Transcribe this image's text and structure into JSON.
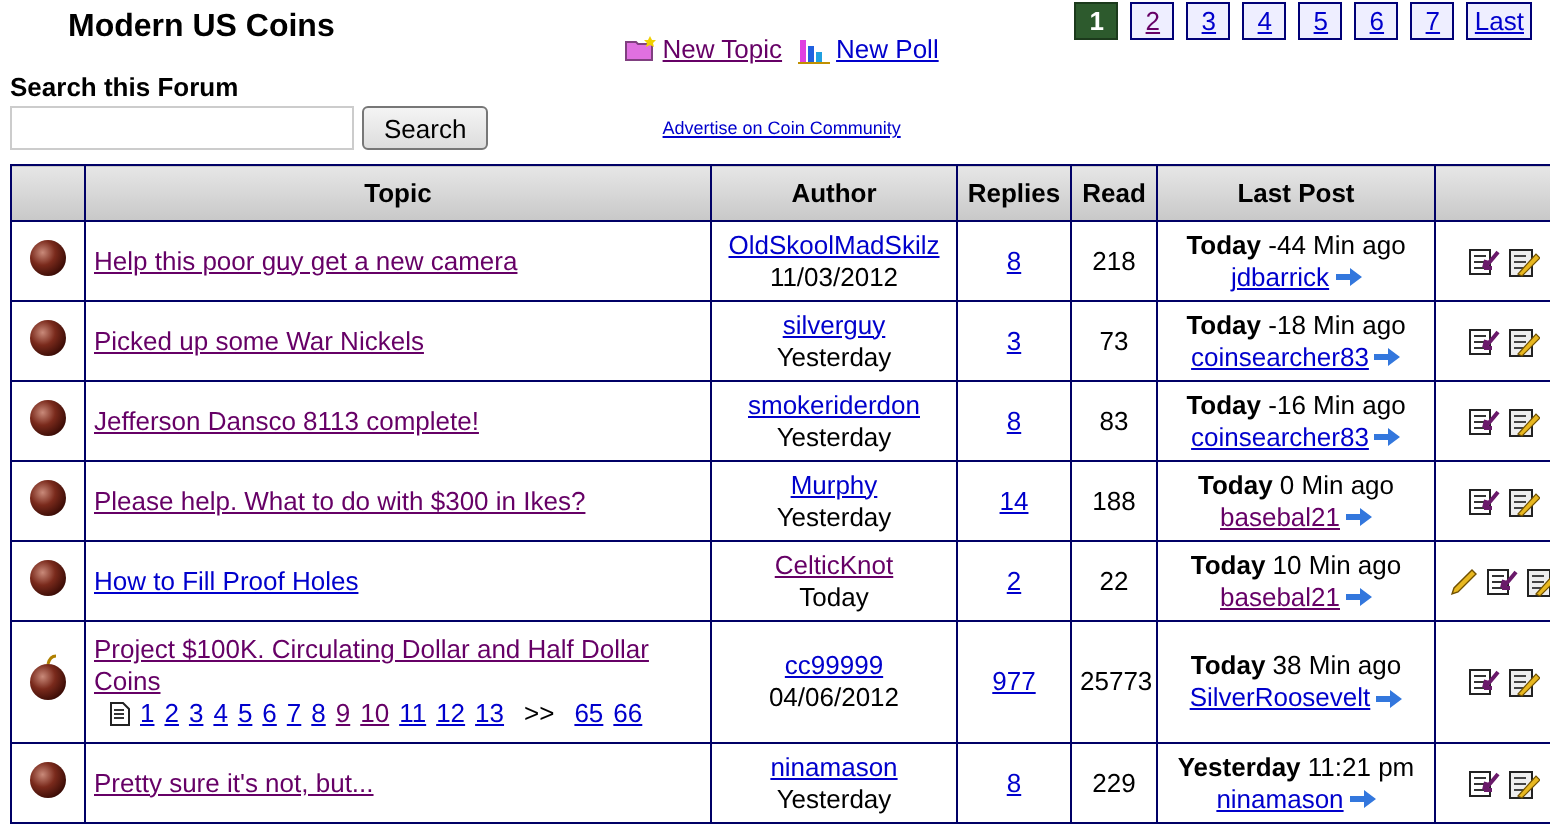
{
  "forum_title": "Modern US Coins",
  "actions": [
    {
      "kind": "topic",
      "label": "New Topic",
      "visited": true
    },
    {
      "kind": "poll",
      "label": "New Poll",
      "visited": false
    }
  ],
  "pagination": [
    {
      "label": "1",
      "selected": true,
      "visited": false
    },
    {
      "label": "2",
      "selected": false,
      "visited": true
    },
    {
      "label": "3",
      "selected": false,
      "visited": false
    },
    {
      "label": "4",
      "selected": false,
      "visited": false
    },
    {
      "label": "5",
      "selected": false,
      "visited": false
    },
    {
      "label": "6",
      "selected": false,
      "visited": false
    },
    {
      "label": "7",
      "selected": false,
      "visited": false
    },
    {
      "label": "Last",
      "selected": false,
      "visited": false
    }
  ],
  "search": {
    "label": "Search this Forum",
    "button": "Search"
  },
  "advertise_link": "Advertise on Coin Community",
  "table": {
    "columns": [
      "Topic",
      "Author",
      "Replies",
      "Read",
      "Last Post"
    ],
    "rows": [
      {
        "kind": "normal",
        "topic": "Help this poor guy get a new camera",
        "topic_visited": true,
        "author": "OldSkoolMadSkilz",
        "author_visited": false,
        "date": "11/03/2012",
        "replies": "8",
        "read": "218",
        "last_day": "Today",
        "last_time": "-44 Min ago",
        "last_user": "jdbarrick",
        "last_user_visited": false,
        "editable": false
      },
      {
        "kind": "normal",
        "topic": "Picked up some War Nickels",
        "topic_visited": true,
        "author": "silverguy",
        "author_visited": false,
        "date": "Yesterday",
        "replies": "3",
        "read": "73",
        "last_day": "Today",
        "last_time": "-18 Min ago",
        "last_user": "coinsearcher83",
        "last_user_visited": false,
        "editable": false
      },
      {
        "kind": "normal",
        "topic": "Jefferson Dansco 8113 complete!",
        "topic_visited": true,
        "author": "smokeriderdon",
        "author_visited": false,
        "date": "Yesterday",
        "replies": "8",
        "read": "83",
        "last_day": "Today",
        "last_time": "-16 Min ago",
        "last_user": "coinsearcher83",
        "last_user_visited": false,
        "editable": false
      },
      {
        "kind": "normal",
        "topic": "Please help. What to do with $300 in Ikes?",
        "topic_visited": true,
        "author": "Murphy",
        "author_visited": false,
        "date": "Yesterday",
        "replies": "14",
        "read": "188",
        "last_day": "Today",
        "last_time": "0 Min ago",
        "last_user": "basebal21",
        "last_user_visited": true,
        "editable": false
      },
      {
        "kind": "normal",
        "topic": "How to Fill Proof Holes",
        "topic_visited": false,
        "author": "CelticKnot",
        "author_visited": true,
        "date": "Today",
        "replies": "2",
        "read": "22",
        "last_day": "Today",
        "last_time": "10 Min ago",
        "last_user": "basebal21",
        "last_user_visited": true,
        "editable": true
      },
      {
        "kind": "hot",
        "topic": "Project $100K. Circulating Dollar and Half Dollar Coins",
        "topic_visited": true,
        "author": "cc99999",
        "author_visited": false,
        "date": "04/06/2012",
        "replies": "977",
        "read": "25773",
        "last_day": "Today",
        "last_time": "38 Min ago",
        "last_user": "SilverRoosevelt",
        "last_user_visited": false,
        "editable": false,
        "pages": [
          {
            "label": "1",
            "visited": false
          },
          {
            "label": "2",
            "visited": false
          },
          {
            "label": "3",
            "visited": false
          },
          {
            "label": "4",
            "visited": false
          },
          {
            "label": "5",
            "visited": false
          },
          {
            "label": "6",
            "visited": false
          },
          {
            "label": "7",
            "visited": false
          },
          {
            "label": "8",
            "visited": false
          },
          {
            "label": "9",
            "visited": true
          },
          {
            "label": "10",
            "visited": true
          },
          {
            "label": "11",
            "visited": false
          },
          {
            "label": "12",
            "visited": false
          },
          {
            "label": "13",
            "visited": false
          },
          {
            "label": ">>",
            "kind": "gap"
          },
          {
            "label": "65",
            "visited": false
          },
          {
            "label": "66",
            "visited": false
          }
        ]
      },
      {
        "kind": "normal",
        "topic": "Pretty sure it's not, but...",
        "topic_visited": true,
        "author": "ninamason",
        "author_visited": false,
        "date": "Yesterday",
        "replies": "8",
        "read": "229",
        "last_day": "Yesterday",
        "last_time": "11:21 pm",
        "last_user": "ninamason",
        "last_user_visited": false,
        "editable": false
      }
    ]
  }
}
